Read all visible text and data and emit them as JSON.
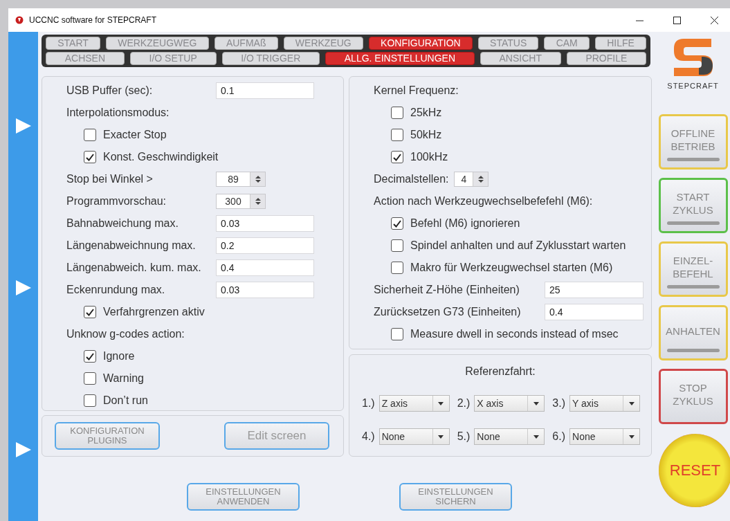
{
  "window": {
    "title": "UCCNC software for STEPCRAFT"
  },
  "tabs": [
    [
      {
        "label": "START",
        "selected": false
      },
      {
        "label": "WERKZEUGWEG",
        "selected": false
      },
      {
        "label": "AUFMAß",
        "selected": false
      },
      {
        "label": "WERKZEUG",
        "selected": false
      },
      {
        "label": "KONFIGURATION",
        "selected": true
      },
      {
        "label": "STATUS",
        "selected": false
      },
      {
        "label": "CAM",
        "selected": false
      },
      {
        "label": "HILFE",
        "selected": false
      }
    ],
    [
      {
        "label": "ACHSEN",
        "selected": false
      },
      {
        "label": "I/O SETUP",
        "selected": false
      },
      {
        "label": "I/O TRIGGER",
        "selected": false
      },
      {
        "label": "ALLG. EINSTELLUNGEN",
        "selected": true
      },
      {
        "label": "ANSICHT",
        "selected": false
      },
      {
        "label": "PROFILE",
        "selected": false
      }
    ]
  ],
  "left_settings": [
    {
      "kind": "field",
      "label": "USB Puffer (sec):",
      "value": "0.1"
    },
    {
      "kind": "heading",
      "label": "Interpolationsmodus:"
    },
    {
      "kind": "checkbox",
      "label": "Exacter Stop",
      "checked": false
    },
    {
      "kind": "checkbox",
      "label": "Konst. Geschwindigkeit",
      "checked": true
    },
    {
      "kind": "spinner",
      "label": "Stop bei Winkel >",
      "value": "89"
    },
    {
      "kind": "spinner",
      "label": "Programmvorschau:",
      "value": "300"
    },
    {
      "kind": "field",
      "label": "Bahnabweichung max.",
      "value": "0.03"
    },
    {
      "kind": "field",
      "label": "Längenabweichnung max.",
      "value": "0.2"
    },
    {
      "kind": "field",
      "label": "Längenabweich. kum. max.",
      "value": "0.4"
    },
    {
      "kind": "field",
      "label": "Eckenrundung max.",
      "value": "0.03"
    },
    {
      "kind": "checkbox",
      "label": "Verfahrgrenzen aktiv",
      "checked": true
    },
    {
      "kind": "heading",
      "label": "Unknow g-codes action:"
    },
    {
      "kind": "checkbox",
      "label": "Ignore",
      "checked": true
    },
    {
      "kind": "checkbox",
      "label": "Warning",
      "checked": false
    },
    {
      "kind": "checkbox",
      "label": "Don’t run",
      "checked": false
    }
  ],
  "left_buttons": [
    "KONFIGURATION\nPLUGINS",
    "Edit screen"
  ],
  "right_settings": [
    {
      "kind": "heading",
      "label": "Kernel Frequenz:"
    },
    {
      "kind": "checkbox",
      "label": "25kHz",
      "checked": false
    },
    {
      "kind": "checkbox",
      "label": "50kHz",
      "checked": false
    },
    {
      "kind": "checkbox",
      "label": "100kHz",
      "checked": true
    },
    {
      "kind": "inline-spinner",
      "label": "Decimalstellen:",
      "value": "4"
    },
    {
      "kind": "heading",
      "label": "Action nach Werkzeugwechselbefefehl (M6):"
    },
    {
      "kind": "checkbox",
      "label": "Befehl (M6) ignorieren",
      "checked": true
    },
    {
      "kind": "checkbox",
      "label": "Spindel anhalten und auf Zyklusstart warten",
      "checked": false
    },
    {
      "kind": "checkbox",
      "label": "Makro für Werkzeugwechsel starten (M6)",
      "checked": false
    },
    {
      "kind": "field",
      "label": "Sicherheit Z-Höhe (Einheiten)",
      "value": "25"
    },
    {
      "kind": "field",
      "label": "Zurücksetzen G73 (Einheiten)",
      "value": "0.4"
    },
    {
      "kind": "checkbox",
      "label": "Measure dwell in seconds instead of msec",
      "checked": false
    }
  ],
  "referenzfahrt": {
    "title": "Referenzfahrt:",
    "slots": [
      {
        "number": "1.)",
        "value": "Z axis"
      },
      {
        "number": "2.)",
        "value": "X axis"
      },
      {
        "number": "3.)",
        "value": "Y axis"
      },
      {
        "number": "4.)",
        "value": "None"
      },
      {
        "number": "5.)",
        "value": "None"
      },
      {
        "number": "6.)",
        "value": "None"
      }
    ]
  },
  "bottom_buttons": [
    "EINSTELLUNGEN\nANWENDEN",
    "EINSTELLUNGEN\nSICHERN"
  ],
  "logo": {
    "text": "STEPCRAFT"
  },
  "machine_buttons": [
    {
      "label": "OFFLINE\nBETRIEB",
      "color": "#e8c84a",
      "indicator": true
    },
    {
      "label": "START\nZYKLUS",
      "color": "#5cc04a",
      "indicator": true
    },
    {
      "label": "EINZEL-\nBEFEHL",
      "color": "#e8c84a",
      "indicator": true
    },
    {
      "label": "ANHALTEN",
      "color": "#e8c84a",
      "indicator": true
    },
    {
      "label": "STOP\nZYKLUS",
      "color": "#d0484a",
      "indicator": false
    }
  ],
  "reset": {
    "label": "RESET"
  }
}
